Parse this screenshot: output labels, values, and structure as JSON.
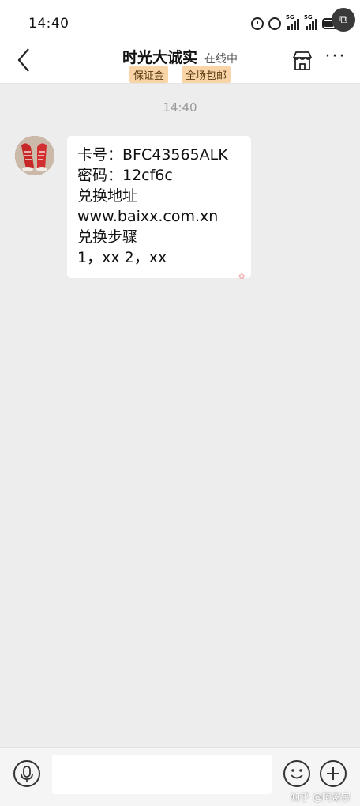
{
  "status_bar": {
    "time": "14:40",
    "network_1": "5G",
    "network_2": "5G",
    "icons": [
      "alarm-icon",
      "clock-icon",
      "signal-icon",
      "battery-icon"
    ],
    "screenshot_icon": "screenshot-icon"
  },
  "header": {
    "back_icon": "chevron-left-icon",
    "shop_name": "时光大诚实",
    "online_status": "在线中",
    "badges": [
      "保证金",
      "全场包邮"
    ],
    "store_icon": "store-icon",
    "more_label": "···"
  },
  "chat": {
    "timestamp": "14:40",
    "messages": [
      {
        "sender": "shop",
        "lines": [
          "卡号：BFC43565ALK",
          "密码：12cf6c",
          "兑换地址",
          "www.baixx.com.xn",
          "兑换步骤",
          "1，xx  2，xx"
        ]
      }
    ]
  },
  "input_bar": {
    "voice_icon": "microphone-icon",
    "placeholder": "",
    "emoji_icon": "emoji-icon",
    "plus_icon": "plus-icon"
  },
  "watermark": "知乎 @阿寄宗",
  "colors": {
    "chat_background": "#ededed",
    "badge_background": "#f9d4a7",
    "bubble": "#ffffff"
  }
}
